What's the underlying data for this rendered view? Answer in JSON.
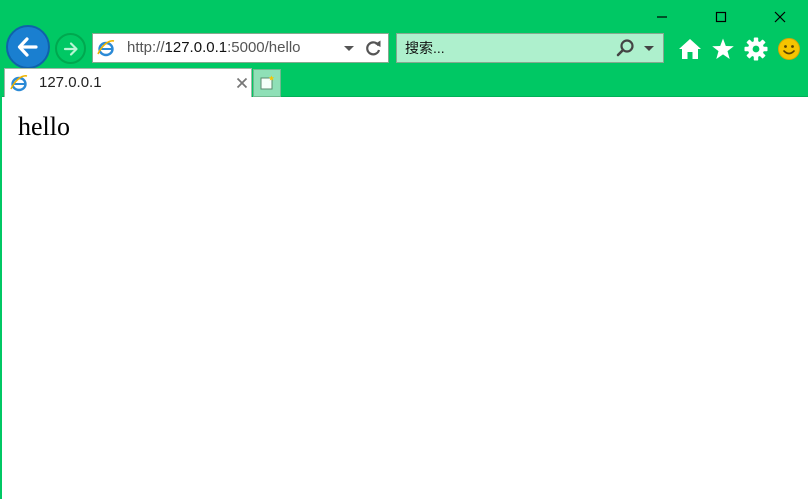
{
  "window": {
    "minimize_icon": "minimize-icon",
    "maximize_icon": "maximize-icon",
    "close_icon": "close-icon"
  },
  "navigation": {
    "back_icon": "back-arrow-icon",
    "forward_icon": "forward-arrow-icon"
  },
  "address": {
    "scheme": "http://",
    "host": "127.0.0.1",
    "rest": ":5000/hello",
    "site_icon": "ie-logo-icon",
    "dropdown_icon": "chevron-down-icon",
    "refresh_icon": "refresh-icon"
  },
  "search": {
    "placeholder": "搜索...",
    "search_icon": "search-icon",
    "dropdown_icon": "chevron-down-icon"
  },
  "toolbar": {
    "icons": [
      "home-icon",
      "star-icon",
      "gear-icon",
      "smiley-icon"
    ]
  },
  "tabs": [
    {
      "title": "127.0.0.1",
      "icon": "ie-logo-icon",
      "close_icon": "close-icon"
    }
  ],
  "new_tab_icon": "new-tab-icon",
  "page": {
    "text": "hello"
  },
  "colors": {
    "chrome": "#00c864",
    "back_button": "#1a7fd0",
    "search_bg": "#aef0cd",
    "smiley": "#f5c400"
  }
}
